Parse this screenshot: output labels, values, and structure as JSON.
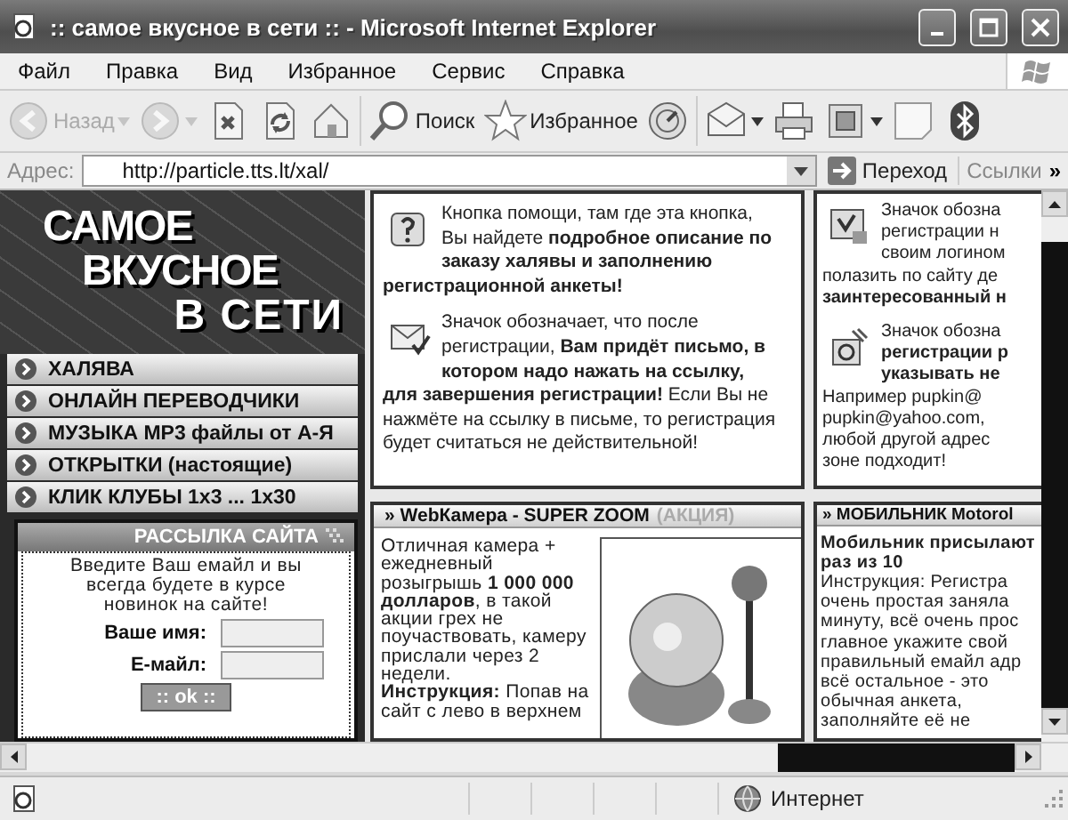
{
  "window": {
    "title": ":: самое вкусное в сети :: - Microsoft Internet Explorer"
  },
  "menu": [
    "Файл",
    "Правка",
    "Вид",
    "Избранное",
    "Сервис",
    "Справка"
  ],
  "toolbar": [
    {
      "kind": "back",
      "label": "Назад",
      "disabled": true
    },
    {
      "kind": "forward",
      "disabled": true
    },
    {
      "kind": "stop",
      "disabled": false
    },
    {
      "kind": "refresh",
      "disabled": false
    },
    {
      "kind": "home",
      "disabled": false
    },
    {
      "kind": "search",
      "label": "Поиск",
      "disabled": false
    },
    {
      "kind": "favorites",
      "label": "Избранное",
      "disabled": false
    },
    {
      "kind": "media",
      "disabled": false
    },
    {
      "kind": "mail",
      "disabled": false
    },
    {
      "kind": "print",
      "disabled": false
    },
    {
      "kind": "edit",
      "disabled": false
    },
    {
      "kind": "note",
      "disabled": false
    },
    {
      "kind": "bluetooth",
      "disabled": false
    }
  ],
  "address": {
    "label": "Адрес:",
    "value": "http://particle.tts.lt/xal/",
    "go": "Переход",
    "links": "Ссылки",
    "more": "»"
  },
  "sidebar": {
    "logo": [
      "САМОЕ",
      "ВКУСНОЕ",
      "В СЕТИ"
    ],
    "nav": [
      "ХАЛЯВА",
      "ОНЛАЙН ПЕРЕВОДЧИКИ",
      "МУЗЫКА MP3 файлы от А-Я",
      "ОТКРЫТКИ (настоящие)",
      "КЛИК КЛУБЫ 1х3 ... 1х30"
    ],
    "newsletter": {
      "title": "РАССЫЛКА САЙТА",
      "text": "Введите Ваш емайл и вы всегда будете в курсе новинок на сайте!",
      "fields": [
        {
          "label": "Ваше имя:"
        },
        {
          "label": "Е-майл:"
        }
      ],
      "button": ":: ok ::"
    }
  },
  "info_boxes": [
    {
      "paragraphs": [
        {
          "kind": "help",
          "lines": [
            "Кнопка помощи, там где эта кнопка,",
            "Вы найдете **подробное описание по**",
            "**заказу халявы и заполнению**",
            "**регистрационной анкеты!**"
          ]
        },
        {
          "kind": "mail",
          "lines": [
            "Значок обозначает, что после",
            "регистрации, **Вам придёт письмо, в**",
            "**котором надо нажать на ссылку,**",
            "**для завершения регистрации!** Если Вы не",
            "нажмёте на ссылку в письме, то регистрация",
            "будет считаться не действительной!"
          ]
        }
      ]
    },
    {
      "paragraphs": [
        {
          "kind": "user",
          "lines": [
            "Значок обозна",
            "регистрации н",
            "своим логином",
            "полазить по сайту де",
            "**заинтересованный н**"
          ]
        },
        {
          "kind": "at",
          "lines": [
            "Значок обозна",
            "**регистрации р**",
            "**указывать не**",
            "Например pupkin@",
            "pupkin@yahoo.com,",
            "любой другой адрес",
            "зоне подходит!"
          ]
        }
      ]
    }
  ],
  "panels": [
    {
      "kind": "photo",
      "title": "» WebКамера - SUPER ZOOM",
      "tag": "(АКЦИЯ)",
      "lines": [
        "Отличная камера +",
        "ежедневный",
        "розыгрышь **1 000 000**",
        "**долларов**, в такой",
        "акции грех не",
        "поучаствовать, камеру",
        "прислали через 2",
        "недели.",
        "**Инструкция:** Попав на",
        "сайт с лево в верхнем"
      ]
    },
    {
      "kind": "text",
      "title": "» МОБИЛЬНИК Motorol",
      "lines": [
        "**Мобильник присылают**",
        "**раз из 10**",
        "Инструкция: Регистра",
        "очень простая заняла",
        "минуту, всё очень прос",
        "главное укажите свой",
        "правильный емайл адр",
        "всё остальное - это",
        "обычная анкета,",
        "заполняйте её не"
      ]
    }
  ],
  "status": {
    "zone": "Интернет"
  }
}
